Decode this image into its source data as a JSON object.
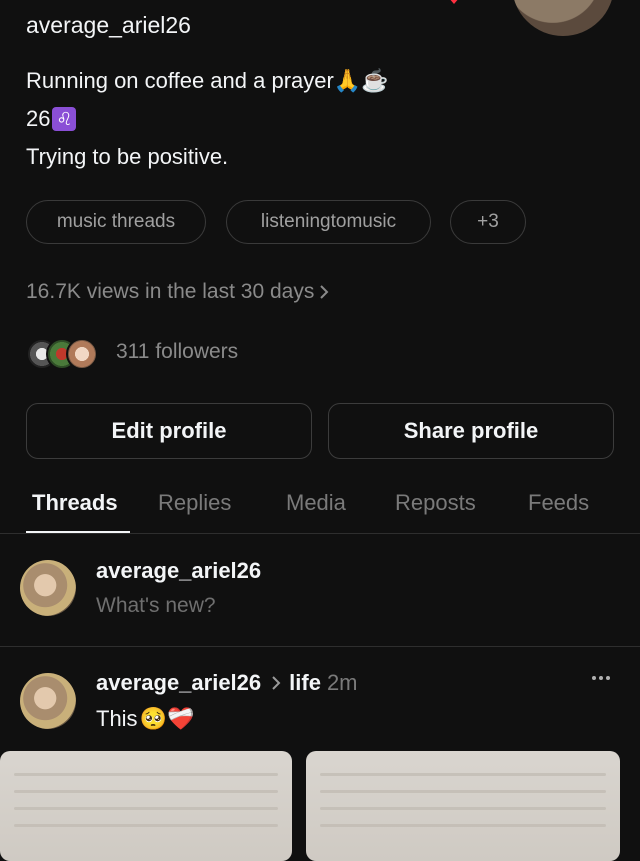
{
  "profile": {
    "username": "average_ariel26",
    "bio": {
      "line1": "Running on coffee and a prayer🙏☕️",
      "line2_age": "26",
      "line2_sign": "♌︎",
      "line3": "Trying to be positive."
    },
    "tags": [
      "music threads",
      "listeningtomusic",
      "+3"
    ],
    "views": "16.7K views in the last 30 days",
    "followers": "311 followers"
  },
  "actions": {
    "edit": "Edit profile",
    "share": "Share profile"
  },
  "tabs": [
    "Threads",
    "Replies",
    "Media",
    "Reposts",
    "Feeds"
  ],
  "composer": {
    "username": "average_ariel26",
    "placeholder": "What's new?"
  },
  "post": {
    "username": "average_ariel26",
    "topic": "life",
    "time": "2m",
    "text": "This",
    "emojis": "🥺❤️‍🩹"
  },
  "colors": {
    "background": "#101010",
    "text": "#f3f5f7",
    "muted": "#7a7a7a",
    "border": "#3a3a3a",
    "leo_badge": "#8a4fd6"
  },
  "icons": {
    "views_chevron": "chevron-right-icon",
    "topic_chevron": "chevron-right-icon",
    "more": "more-horizontal-icon"
  }
}
